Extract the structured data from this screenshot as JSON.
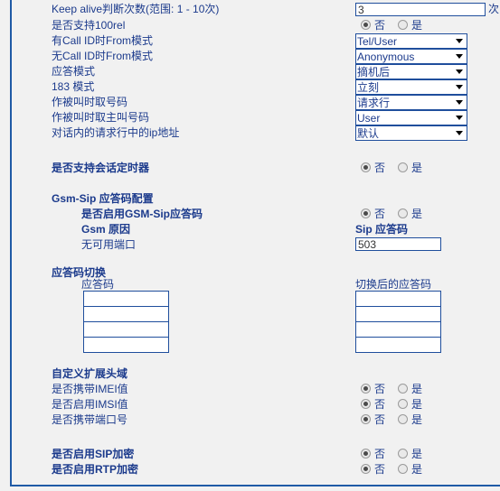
{
  "form": {
    "rows": [
      {
        "id": "keep-alive-count",
        "label": "Keep alive判断次数(范围: 1 - 10次)",
        "type": "text",
        "value": "3",
        "unit": "次"
      },
      {
        "id": "support-100rel",
        "label": "是否支持100rel",
        "type": "radio",
        "options": [
          "否",
          "是"
        ],
        "selected": "否"
      },
      {
        "id": "from-mode-with-callid",
        "label": "有Call ID时From模式",
        "type": "select",
        "value": "Tel/User"
      },
      {
        "id": "from-mode-without-callid",
        "label": "无Call ID时From模式",
        "type": "select",
        "value": "Anonymous"
      },
      {
        "id": "answer-mode",
        "label": "应答模式",
        "type": "select",
        "value": "摘机后"
      },
      {
        "id": "mode-183",
        "label": "183 模式",
        "type": "select",
        "value": "立刻"
      },
      {
        "id": "called-get-number",
        "label": "作被叫时取号码",
        "type": "select",
        "value": "请求行"
      },
      {
        "id": "called-get-caller-number",
        "label": "作被叫时取主叫号码",
        "type": "select",
        "value": "User"
      },
      {
        "id": "in-dialog-request-ip",
        "label": "对话内的请求行中的ip地址",
        "type": "select",
        "value": "默认"
      }
    ],
    "session_timer": {
      "label": "是否支持会话定时器",
      "options": [
        "否",
        "是"
      ],
      "selected": "否"
    },
    "gsm_sip": {
      "heading": "Gsm-Sip 应答码配置",
      "enable_label": "是否启用GSM-Sip应答码",
      "enable_options": [
        "否",
        "是"
      ],
      "enable_selected": "否",
      "gsm_cause_header": "Gsm 原因",
      "sip_code_header": "Sip 应答码",
      "entries": [
        {
          "cause": "无可用端口",
          "code": "503"
        }
      ]
    },
    "code_switch": {
      "heading": "应答码切换",
      "col_left_header": "应答码",
      "col_right_header": "切换后的应答码",
      "rows": [
        {
          "from": "",
          "to": ""
        },
        {
          "from": "",
          "to": ""
        },
        {
          "from": "",
          "to": ""
        },
        {
          "from": "",
          "to": ""
        }
      ]
    },
    "custom_headers": {
      "heading": "自定义扩展头域",
      "items": [
        {
          "id": "carry-imei",
          "label": "是否携带IMEI值",
          "options": [
            "否",
            "是"
          ],
          "selected": "否"
        },
        {
          "id": "enable-imsi",
          "label": "是否启用IMSI值",
          "options": [
            "否",
            "是"
          ],
          "selected": "否"
        },
        {
          "id": "carry-port",
          "label": "是否携带端口号",
          "options": [
            "否",
            "是"
          ],
          "selected": "否"
        }
      ]
    },
    "encryption": {
      "items": [
        {
          "id": "sip-encrypt",
          "label": "是否启用SIP加密",
          "options": [
            "否",
            "是"
          ],
          "selected": "否"
        },
        {
          "id": "rtp-encrypt",
          "label": "是否启用RTP加密",
          "options": [
            "否",
            "是"
          ],
          "selected": "否"
        }
      ]
    }
  },
  "colors": {
    "label_blue": "#1b3a8c",
    "border_blue": "#1f4e9c",
    "panel_bg": "#f1f1f1"
  }
}
